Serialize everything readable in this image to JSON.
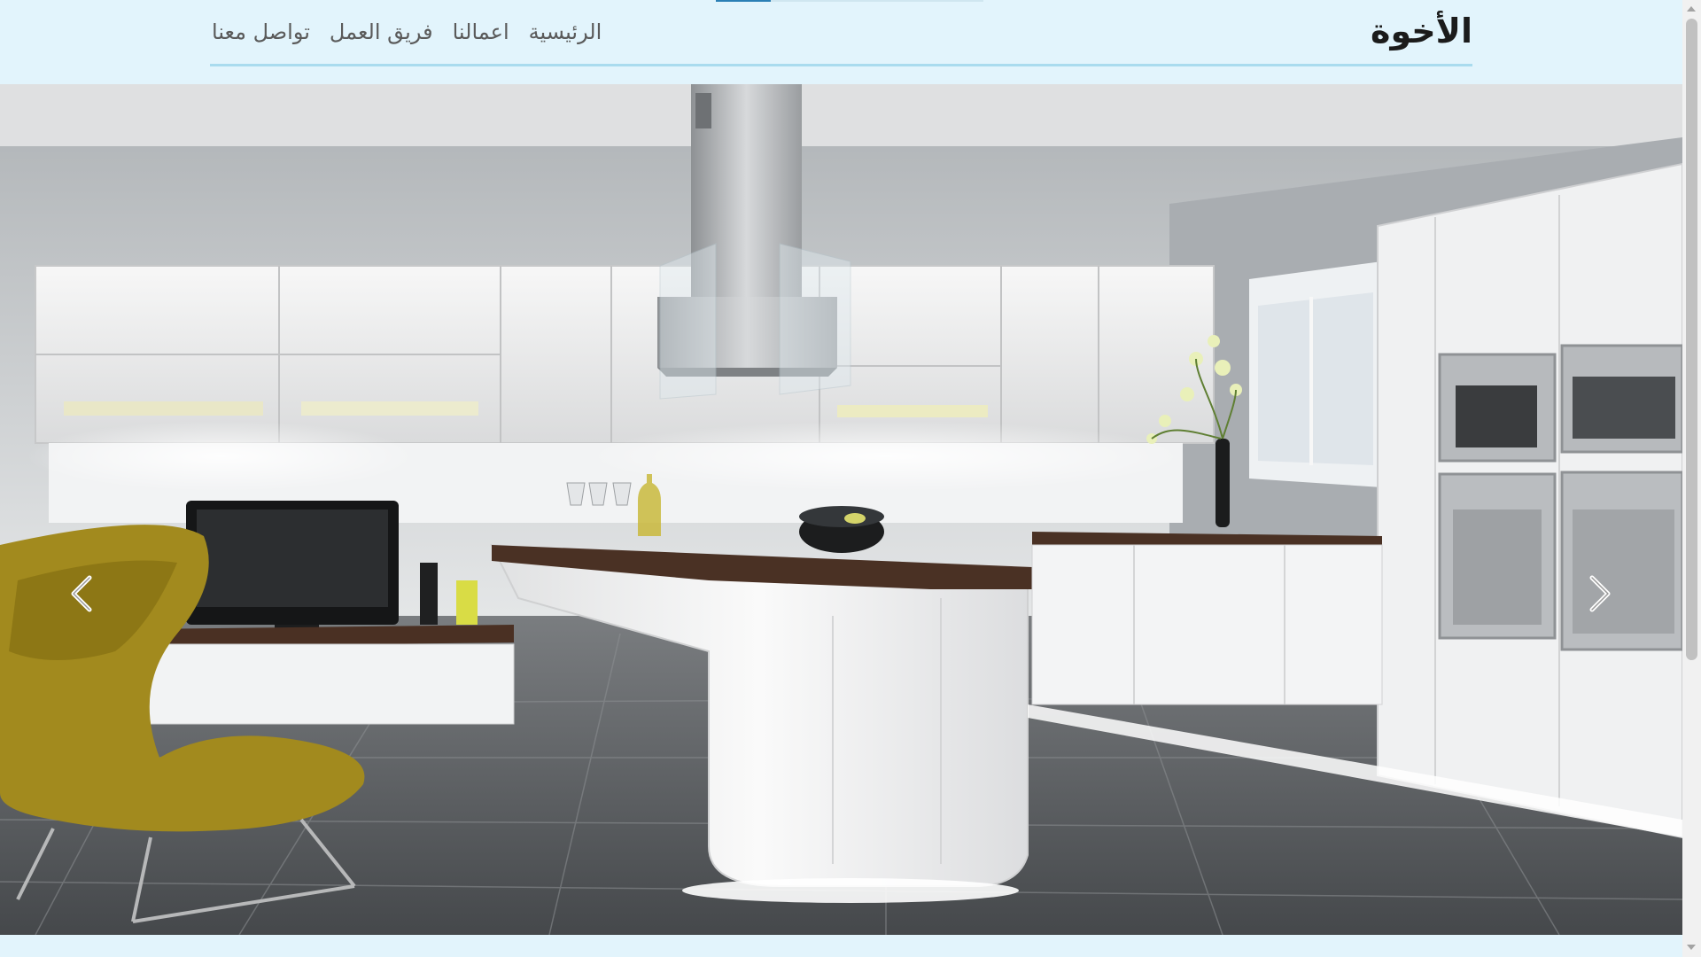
{
  "brand": {
    "name": "الأخوة"
  },
  "nav": {
    "items": [
      {
        "label": "الرئيسية"
      },
      {
        "label": "اعمالنا"
      },
      {
        "label": "فريق العمل"
      },
      {
        "label": "تواصل معنا"
      }
    ]
  },
  "carousel": {
    "prev_icon": "chevron-left-icon",
    "next_icon": "chevron-right-icon",
    "slide_subject": "white modern kitchen photo"
  },
  "colors": {
    "header_bg": "#e2f4fc",
    "nav_border": "#a9dbee",
    "brand_text": "#1b1b1b",
    "nav_text": "#5a5a5a"
  }
}
